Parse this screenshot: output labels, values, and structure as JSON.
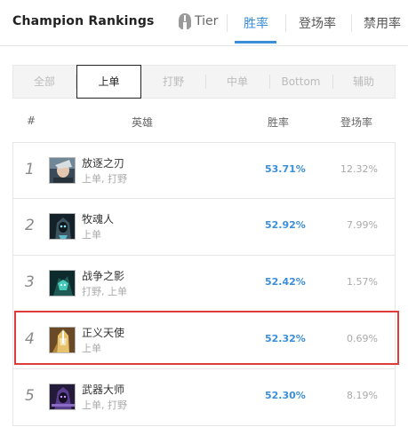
{
  "header": {
    "title": "Champion Rankings",
    "tabs": [
      {
        "label": "Tier",
        "icon": "helmet-icon"
      },
      {
        "label": "胜率",
        "active": true
      },
      {
        "label": "登场率"
      },
      {
        "label": "禁用率"
      }
    ]
  },
  "filter": {
    "positions": [
      "全部",
      "上单",
      "打野",
      "中单",
      "Bottom",
      "辅助"
    ],
    "selected": "上单"
  },
  "columns": {
    "rank": "#",
    "champion": "英雄",
    "winrate": "胜率",
    "pickrate": "登场率"
  },
  "rows": [
    {
      "rank": "1",
      "name": "放逐之刃",
      "positions": "上单, 打野",
      "winrate": "53.71%",
      "pickrate": "12.32%"
    },
    {
      "rank": "2",
      "name": "牧魂人",
      "positions": "上单",
      "winrate": "52.92%",
      "pickrate": "7.99%"
    },
    {
      "rank": "3",
      "name": "战争之影",
      "positions": "打野, 上单",
      "winrate": "52.42%",
      "pickrate": "1.57%"
    },
    {
      "rank": "4",
      "name": "正义天使",
      "positions": "上单",
      "winrate": "52.32%",
      "pickrate": "0.69%",
      "highlighted": true
    },
    {
      "rank": "5",
      "name": "武器大师",
      "positions": "上单, 打野",
      "winrate": "52.30%",
      "pickrate": "8.19%"
    }
  ],
  "colors": {
    "accent": "#3b8ed8",
    "highlight_border": "#e03b3b"
  }
}
